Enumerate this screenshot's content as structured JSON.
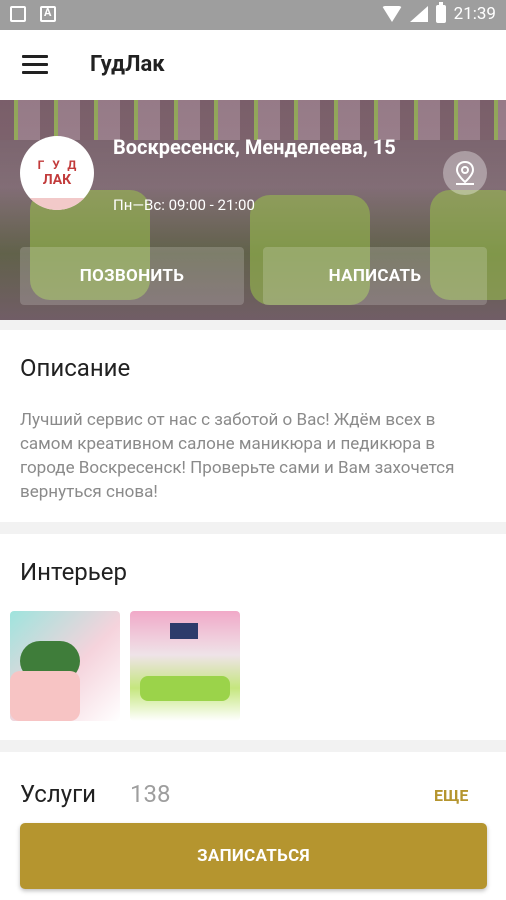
{
  "status_bar": {
    "time": "21:39"
  },
  "app_bar": {
    "title": "ГудЛак",
    "menu_icon": "hamburger-menu-icon"
  },
  "hero": {
    "logo_text_top": "ГУД",
    "logo_text_mid": "ЛАК",
    "address": "Воскресенск, Менделеева, 15",
    "hours": "Пн—Вс: 09:00 - 21:00",
    "map_icon": "map-pin-icon",
    "call_label": "ПОЗВОНИТЬ",
    "write_label": "НАПИСАТЬ"
  },
  "description": {
    "title": "Описание",
    "text": "Лучший сервис от нас с заботой о Вас! Ждём всех в самом креативном салоне маникюра и педикюра в городе Воскресенск! Проверьте сами и Вам захочется вернуться снова!"
  },
  "interior": {
    "title": "Интерьер",
    "photos": [
      "interior-photo-1",
      "interior-photo-2"
    ]
  },
  "services": {
    "title": "Услуги",
    "count": "138",
    "more_label": "ЕЩЕ",
    "book_label": "ЗАПИСАТЬСЯ"
  },
  "colors": {
    "accent": "#b5952f",
    "status_bar": "#9e9e9e",
    "secondary_text": "#8a8a8a"
  }
}
